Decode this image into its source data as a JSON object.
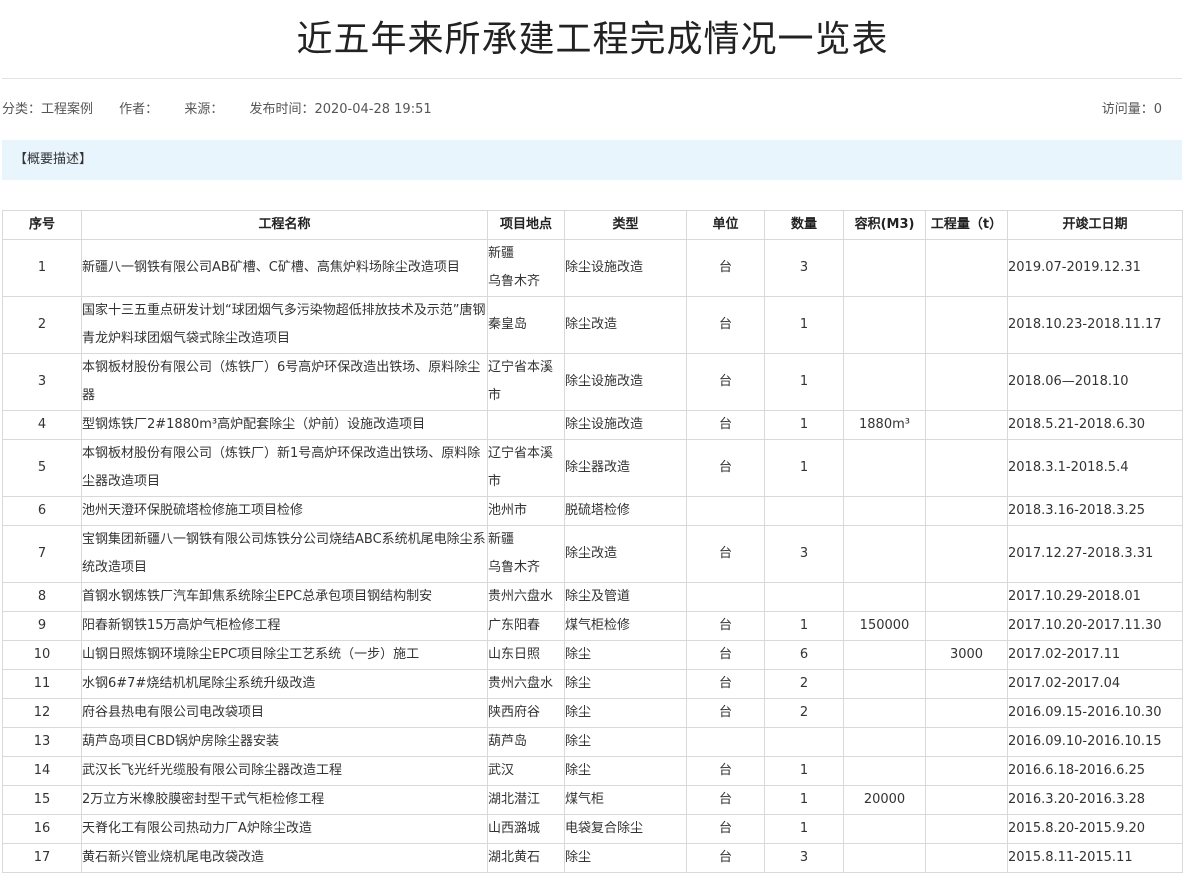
{
  "page": {
    "title": "近五年来所承建工程完成情况一览表",
    "meta": {
      "category": "分类：工程案例",
      "author": "作者：",
      "source": "来源：",
      "published": "发布时间：2020-04-28 19:51",
      "visits": "访问量：0"
    },
    "summary_label": "【概要描述】"
  },
  "table": {
    "headers": [
      "序号",
      "工程名称",
      "项目地点",
      "类型",
      "单位",
      "数量",
      "容积(M3)",
      "工程量（t）",
      "开竣工日期"
    ],
    "rows": [
      {
        "no": "1",
        "name": "新疆八一钢铁有限公司AB矿槽、C矿槽、高焦炉料场除尘改造项目",
        "loc": "新疆\n乌鲁木齐",
        "type": "除尘设施改造",
        "unit": "台",
        "qty": "3",
        "vol": "",
        "weight": "",
        "date": "2019.07-2019.12.31",
        "tall": true
      },
      {
        "no": "2",
        "name": "国家十三五重点研发计划“球团烟气多污染物超低排放技术及示范”唐钢青龙炉料球团烟气袋式除尘改造项目",
        "loc": "秦皇岛",
        "type": "除尘改造",
        "unit": "台",
        "qty": "1",
        "vol": "",
        "weight": "",
        "date": "2018.10.23-2018.11.17",
        "tall": true
      },
      {
        "no": "3",
        "name": "本钢板材股份有限公司（炼铁厂）6号高炉环保改造出铁场、原料除尘器",
        "loc": "辽宁省本溪市",
        "type": "除尘设施改造",
        "unit": "台",
        "qty": "1",
        "vol": "",
        "weight": "",
        "date": "2018.06—2018.10",
        "tall": true
      },
      {
        "no": "4",
        "name": "型钢炼铁厂2#1880m³高炉配套除尘（炉前）设施改造项目",
        "loc": "",
        "type": "除尘设施改造",
        "unit": "台",
        "qty": "1",
        "vol": "1880m³",
        "weight": "",
        "date": "2018.5.21-2018.6.30",
        "tall": false
      },
      {
        "no": "5",
        "name": "本钢板材股份有限公司（炼铁厂）新1号高炉环保改造出铁场、原料除尘器改造项目",
        "loc": "辽宁省本溪市",
        "type": "除尘器改造",
        "unit": "台",
        "qty": "1",
        "vol": "",
        "weight": "",
        "date": "2018.3.1-2018.5.4",
        "tall": true
      },
      {
        "no": "6",
        "name": "池州天澄环保脱硫塔检修施工项目检修",
        "loc": "池州市",
        "type": "脱硫塔检修",
        "unit": "",
        "qty": "",
        "vol": "",
        "weight": "",
        "date": "2018.3.16-2018.3.25",
        "tall": false
      },
      {
        "no": "7",
        "name": "宝钢集团新疆八一钢铁有限公司炼铁分公司烧结ABC系统机尾电除尘系统改造项目",
        "loc": "新疆\n乌鲁木齐",
        "type": "除尘改造",
        "unit": "台",
        "qty": "3",
        "vol": "",
        "weight": "",
        "date": "2017.12.27-2018.3.31",
        "tall": true
      },
      {
        "no": "8",
        "name": "首钢水钢炼铁厂汽车卸焦系统除尘EPC总承包项目钢结构制安",
        "loc": "贵州六盘水",
        "type": "除尘及管道",
        "unit": "",
        "qty": "",
        "vol": "",
        "weight": "",
        "date": "2017.10.29-2018.01",
        "tall": false
      },
      {
        "no": "9",
        "name": "阳春新钢铁15万高炉气柜检修工程",
        "loc": "广东阳春",
        "type": "煤气柜检修",
        "unit": "台",
        "qty": "1",
        "vol": "150000",
        "weight": "",
        "date": "2017.10.20-2017.11.30",
        "tall": false
      },
      {
        "no": "10",
        "name": "山钢日照炼钢环境除尘EPC项目除尘工艺系统（一步）施工",
        "loc": "山东日照",
        "type": "除尘",
        "unit": "台",
        "qty": "6",
        "vol": "",
        "weight": "3000",
        "date": "2017.02-2017.11",
        "tall": false
      },
      {
        "no": "11",
        "name": "水钢6#7#烧结机机尾除尘系统升级改造",
        "loc": "贵州六盘水",
        "type": "除尘",
        "unit": "台",
        "qty": "2",
        "vol": "",
        "weight": "",
        "date": "2017.02-2017.04",
        "tall": false
      },
      {
        "no": "12",
        "name": "府谷县热电有限公司电改袋项目",
        "loc": "陕西府谷",
        "type": "除尘",
        "unit": "台",
        "qty": "2",
        "vol": "",
        "weight": "",
        "date": "2016.09.15-2016.10.30",
        "tall": false
      },
      {
        "no": "13",
        "name": "葫芦岛项目CBD锅炉房除尘器安装",
        "loc": "葫芦岛",
        "type": "除尘",
        "unit": "",
        "qty": "",
        "vol": "",
        "weight": "",
        "date": "2016.09.10-2016.10.15",
        "tall": false
      },
      {
        "no": "14",
        "name": "武汉长飞光纤光缆股有限公司除尘器改造工程",
        "loc": "武汉",
        "type": "除尘",
        "unit": "台",
        "qty": "1",
        "vol": "",
        "weight": "",
        "date": "2016.6.18-2016.6.25",
        "tall": false
      },
      {
        "no": "15",
        "name": "2万立方米橡胶膜密封型干式气柜检修工程",
        "loc": "湖北潜江",
        "type": "煤气柜",
        "unit": "台",
        "qty": "1",
        "vol": "20000",
        "weight": "",
        "date": "2016.3.20-2016.3.28",
        "tall": false
      },
      {
        "no": "16",
        "name": "天脊化工有限公司热动力厂A炉除尘改造",
        "loc": "山西潞城",
        "type": "电袋复合除尘",
        "unit": "台",
        "qty": "1",
        "vol": "",
        "weight": "",
        "date": "2015.8.20-2015.9.20",
        "tall": false
      },
      {
        "no": "17",
        "name": "黄石新兴管业烧机尾电改袋改造",
        "loc": "湖北黄石",
        "type": "除尘",
        "unit": "台",
        "qty": "3",
        "vol": "",
        "weight": "",
        "date": "2015.8.11-2015.11",
        "tall": false
      }
    ]
  }
}
